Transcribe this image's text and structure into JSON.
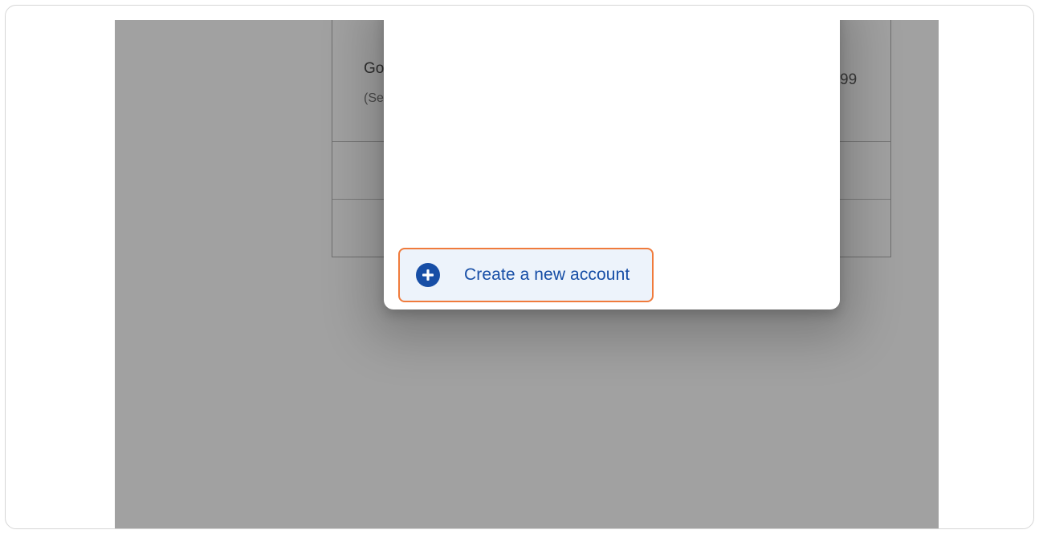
{
  "background_table": {
    "cell_text_1": "Go",
    "cell_text_2": "(Se",
    "price_fragment": "99"
  },
  "dialog": {
    "create_account_label": "Create a new account",
    "create_account_icon": "plus-circle-icon"
  },
  "colors": {
    "overlay": "#a1a1a1",
    "highlight_border": "#f07b3c",
    "primary_blue": "#174ea6",
    "button_background": "#edf3fb"
  }
}
